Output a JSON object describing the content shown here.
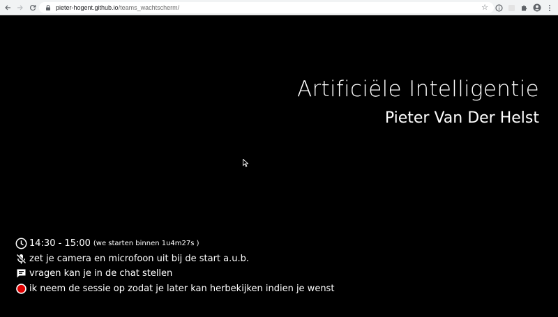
{
  "browser": {
    "url_host": "pieter-hogent.github.io",
    "url_path": "/teams_wachtscherm/"
  },
  "main": {
    "title": "Artificiële Intelligentie",
    "speaker": "Pieter Van Der Helst"
  },
  "info": {
    "time": "14:30 - 15:00",
    "countdown": "(we starten binnen 1u4m27s )",
    "camera_note": "zet je camera en microfoon uit bij de start a.u.b.",
    "chat_note": "vragen kan je in de chat stellen",
    "record_note": "ik neem de sessie op zodat je later kan herbekijken indien je wenst"
  },
  "colors": {
    "background": "#000000",
    "text": "#ffffff",
    "record": "#e00000"
  }
}
